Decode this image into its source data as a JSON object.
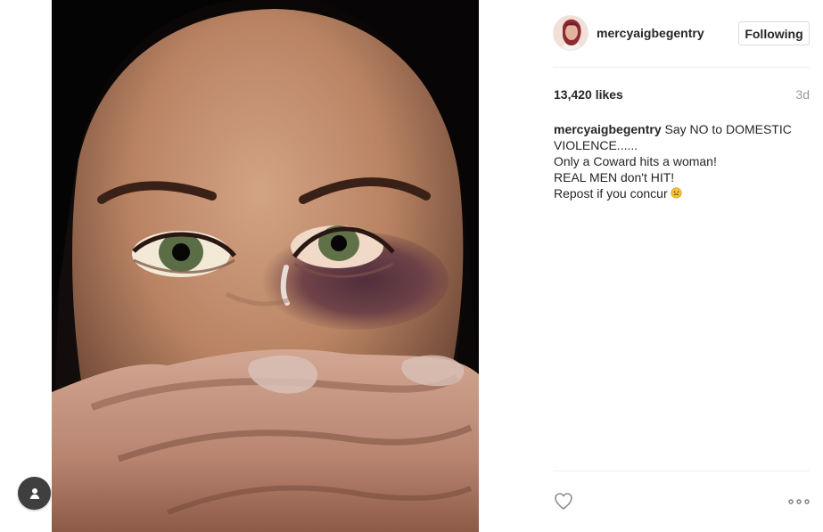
{
  "post": {
    "username": "mercyaigbegentry",
    "follow_label": "Following",
    "likes": "13,420 likes",
    "time": "3d",
    "caption": {
      "author": "mercyaigbegentry",
      "line1": "Say NO to DOMESTIC VIOLENCE......",
      "line2": "Only a Coward hits a woman!",
      "line3": "REAL MEN don't HIT!",
      "line4": "Repost if you concur",
      "emoji": "sad-face-icon"
    }
  },
  "colors": {
    "text": "#262626",
    "muted": "#999999",
    "border": "#dbdbdb"
  }
}
